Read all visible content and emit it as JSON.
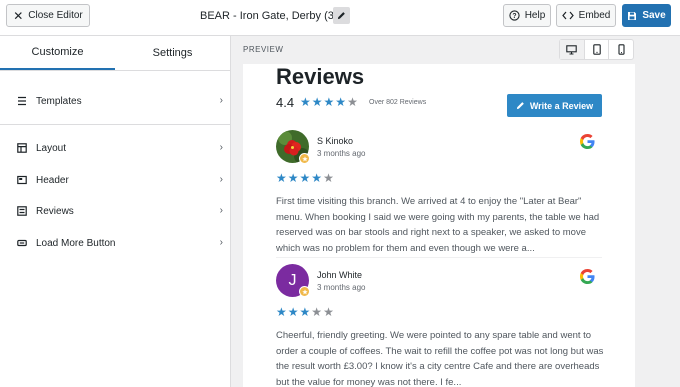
{
  "topbar": {
    "close_label": "Close Editor",
    "title": "BEAR - Iron Gate, Derby (3)",
    "help_label": "Help",
    "embed_label": "Embed",
    "save_label": "Save"
  },
  "sidebar": {
    "tabs": [
      {
        "label": "Customize",
        "active": true
      },
      {
        "label": "Settings",
        "active": false
      }
    ],
    "items": [
      {
        "label": "Templates",
        "icon": "templates-icon"
      },
      {
        "label": "Layout",
        "icon": "layout-icon"
      },
      {
        "label": "Header",
        "icon": "header-icon"
      },
      {
        "label": "Reviews",
        "icon": "reviews-icon"
      },
      {
        "label": "Load More Button",
        "icon": "load-more-icon"
      }
    ]
  },
  "preview": {
    "label": "PREVIEW",
    "devices": [
      "desktop-icon",
      "tablet-icon",
      "mobile-icon"
    ],
    "active_device": "desktop"
  },
  "feed": {
    "title": "Reviews",
    "rating": "4.4",
    "rating_stars": 4.4,
    "over_text": "Over 802 Reviews",
    "write_label": "Write a Review",
    "reviews": [
      {
        "name": "S Kinoko",
        "date": "3 months ago",
        "stars": 4,
        "avatar_letter": "",
        "text": "First time visiting this branch. We arrived at 4 to enjoy the \"Later at Bear\" menu. When booking I said we were going with my parents, the table we had reserved was on bar stools and right next to a speaker, we asked to move which was no problem for them and even though we were a..."
      },
      {
        "name": "John White",
        "date": "3 months ago",
        "stars": 3,
        "avatar_letter": "J",
        "text": "Cheerful, friendly greeting. We were pointed to any spare table and went to order a couple of coffees. The wait to refill the coffee pot was not long but was the result worth £3.00? I know it's a city centre Cafe and there are overheads but the value for money was not there. I fe..."
      }
    ]
  },
  "colors": {
    "accent": "#2271b1",
    "star": "#2e88c6",
    "star_off": "#8c8f94",
    "badge": "#f0b849",
    "avatar_purple": "#7b2ba0"
  }
}
